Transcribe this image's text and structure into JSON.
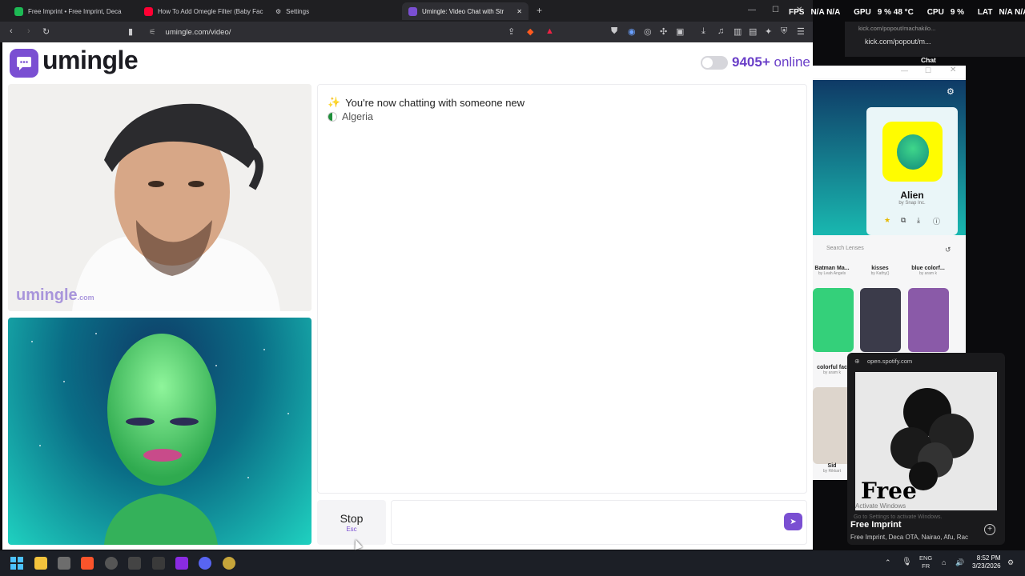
{
  "browser": {
    "tabs": [
      {
        "label": "Free Imprint • Free Imprint, Deca",
        "fav": "#1db954"
      },
      {
        "label": "How To Add Omegle Filter (Baby Fac",
        "fav": "#ff0033"
      },
      {
        "label": "Settings",
        "fav": "#888888"
      },
      {
        "label": "Umingle: Video Chat with Str",
        "fav": "#7a4fd2"
      }
    ],
    "url": "umingle.com/video/"
  },
  "stats": {
    "fps": "FPS",
    "fps_val": "N/A N/A",
    "gpu": "GPU",
    "gpu_val": "9 % 48 °C",
    "cpu": "CPU",
    "cpu_val": "9 %",
    "lat": "LAT",
    "lat_val": "N/A N/A"
  },
  "site": {
    "logo": "umingle",
    "online_count": "9405+",
    "online_label": "online",
    "watermark": "umingle",
    "watermark_suffix": ".com"
  },
  "chat": {
    "status_line": "You're now chatting with someone new",
    "country": "Algeria"
  },
  "controls": {
    "stop_label": "Stop",
    "stop_key": "Esc",
    "message_value": ""
  },
  "kick": {
    "title": "kick.com/popout/machakilo...",
    "url": "kick.com/popout/m...",
    "chat_label": "Chat"
  },
  "snap": {
    "lens_name": "Alien",
    "lens_by": "by Snap Inc.",
    "search_placeholder": "Search Lenses",
    "lenses": [
      {
        "name": "Batman Ma...",
        "by": "by Leah Angels"
      },
      {
        "name": "kisses",
        "by": "by Kathy()"
      },
      {
        "name": "blue colorf...",
        "by": "by aram k"
      }
    ],
    "lenses_row2": [
      {
        "name": "colorful fac",
        "by": "by aram k"
      },
      {
        "name": "Sid",
        "by": "by Rikkart"
      }
    ]
  },
  "spotify": {
    "url": "open.spotify.com",
    "title": "Free Imprint",
    "artists": "Free Imprint, Deca OTA, Nairao, Afu, Rac",
    "art_text": "Free",
    "activate_title": "Activate Windows",
    "activate_sub": "Go to Settings to activate Windows."
  },
  "taskbar": {
    "lang_top": "ENG",
    "lang_bottom": "FR",
    "time": "8:52 PM",
    "date": "3/23/2026"
  },
  "colors": {
    "brand": "#7a4fd2",
    "online": "#6a3fc8"
  }
}
